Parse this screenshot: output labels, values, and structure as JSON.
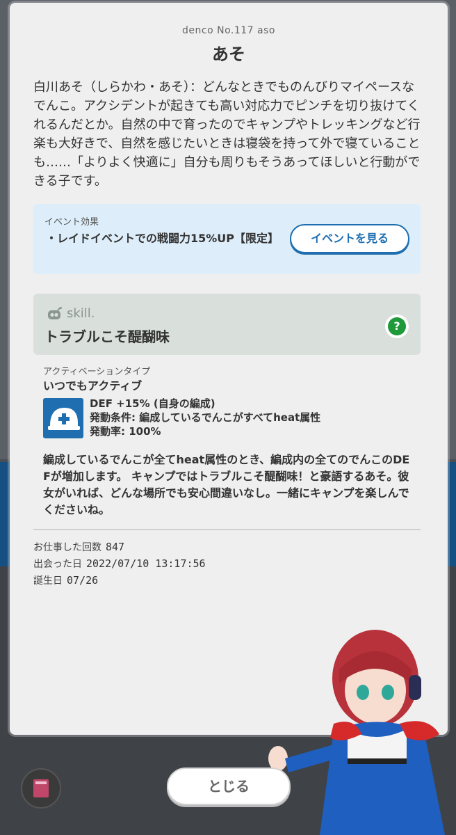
{
  "denco": {
    "number_label": "denco No.117 aso",
    "name": "あそ",
    "description": "白川あそ（しらかわ・あそ）：どんなときでものんびりマイペースなでんこ。アクシデントが起きても高い対応力でピンチを切り抜けてくれるんだとか。自然の中で育ったのでキャンプやトレッキングなど行楽も大好きで、自然を感じたいときは寝袋を持って外で寝ていることも……「よりよく快適に」自分も周りもそうあってほしいと行動ができる子です。"
  },
  "event": {
    "title": "イベント効果",
    "text": "・レイドイベントでの戦闘力15%UP【限定】",
    "button_label": "イベントを見る"
  },
  "skill": {
    "label": "skill.",
    "name": "トラブルこそ醍醐味",
    "help_label": "?",
    "activation_label": "アクティベーションタイプ",
    "activation_value": "いつでもアクティブ",
    "effect_line1": "DEF +15% (自身の編成)",
    "effect_line2": "発動条件: 編成しているでんこがすべてheat属性",
    "effect_line3": "発動率: 100%",
    "description": "編成しているでんこが全てheat属性のとき、編成内の全てのでんこのDEFが増加します。 キャンプではトラブルこそ醍醐味！と豪語するあそ。彼女がいれば、どんな場所でも安心間違いなし。一緒にキャンプを楽しんでくださいね。"
  },
  "stats": {
    "work_count_label": "お仕事した回数",
    "work_count_value": "847",
    "met_date_label": "出会った日",
    "met_date_value": "2022/07/10 13:17:56",
    "birthday_label": "誕生日",
    "birthday_value": "07/26"
  },
  "close_label": "とじる",
  "icons": {
    "skill_icon": "helmet-plus-icon",
    "skill_label_icon": "robot-face-icon",
    "book_icon": "book-icon"
  },
  "colors": {
    "accent_blue": "#1f6fb0",
    "help_green": "#1e9a3a",
    "event_bg": "#ddeefa",
    "skill_bg": "#d9e0dc"
  }
}
